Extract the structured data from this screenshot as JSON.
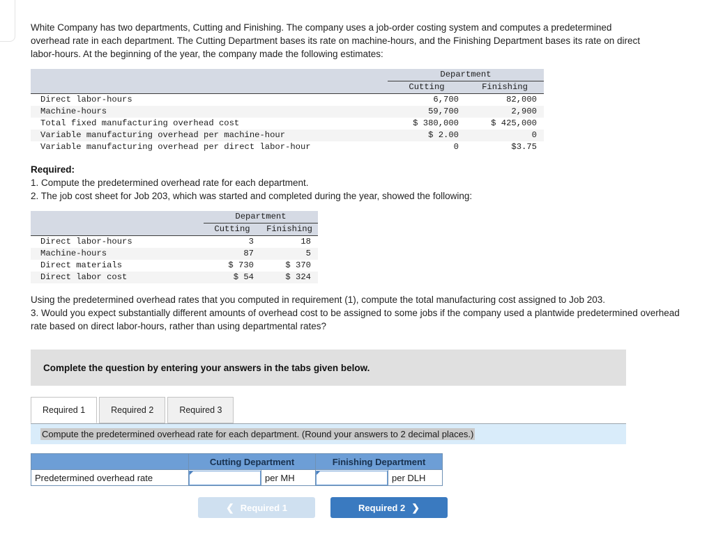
{
  "intro": {
    "paragraph": "White Company has two departments, Cutting and Finishing. The company uses a job-order costing system and computes a predetermined overhead rate in each department. The Cutting Department bases its rate on machine-hours, and the Finishing Department bases its rate on direct labor-hours. At the beginning of the year, the company made the following estimates:"
  },
  "estimates_table": {
    "group_header": "Department",
    "col_headers": [
      "Cutting",
      "Finishing"
    ],
    "rows": [
      {
        "label": "Direct labor-hours",
        "cutting": "6,700",
        "finishing": "82,000"
      },
      {
        "label": "Machine-hours",
        "cutting": "59,700",
        "finishing": "2,900"
      },
      {
        "label": "Total fixed manufacturing overhead cost",
        "cutting": "$ 380,000",
        "finishing": "$ 425,000"
      },
      {
        "label": "Variable manufacturing overhead per machine-hour",
        "cutting": "$ 2.00",
        "finishing": "0"
      },
      {
        "label": "Variable manufacturing overhead per direct labor-hour",
        "cutting": "0",
        "finishing": "$3.75"
      }
    ]
  },
  "required": {
    "heading": "Required:",
    "item1": "1. Compute the predetermined overhead rate for each department.",
    "item2": "2. The job cost sheet for Job 203, which was started and completed during the year, showed the following:"
  },
  "job_table": {
    "group_header": "Department",
    "col_headers": [
      "Cutting",
      "Finishing"
    ],
    "rows": [
      {
        "label": "Direct labor-hours",
        "cutting": "3",
        "finishing": "18"
      },
      {
        "label": "Machine-hours",
        "cutting": "87",
        "finishing": "5"
      },
      {
        "label": "Direct materials",
        "cutting": "$ 730",
        "finishing": "$ 370"
      },
      {
        "label": "Direct labor cost",
        "cutting": "$ 54",
        "finishing": "$ 324"
      }
    ]
  },
  "after_tables": {
    "para1": "Using the predetermined overhead rates that you computed in requirement (1), compute the total manufacturing cost assigned to Job 203.",
    "para2": "3. Would you expect substantially different amounts of overhead cost to be assigned to some jobs if the company used a plantwide predetermined overhead rate based on direct labor-hours, rather than using departmental rates?"
  },
  "banner": {
    "text": "Complete the question by entering your answers in the tabs given below."
  },
  "tabs": [
    {
      "label": "Required 1",
      "active": true
    },
    {
      "label": "Required 2",
      "active": false
    },
    {
      "label": "Required 3",
      "active": false
    }
  ],
  "req_bar": {
    "text": "Compute the predetermined overhead rate for each department. (Round your answers to 2 decimal places.)"
  },
  "answer_table": {
    "header_blank": "",
    "header_cutting": "Cutting Department",
    "header_finishing": "Finishing Department",
    "row_label": "Predetermined overhead rate",
    "cutting_value": "",
    "cutting_unit": "per MH",
    "finishing_value": "",
    "finishing_unit": "per DLH"
  },
  "nav": {
    "prev_label": "Required 1",
    "prev_icon": "chevron-left-icon",
    "next_label": "Required 2",
    "next_icon": "chevron-right-icon"
  },
  "colors": {
    "table_header_bg": "#d5dae4",
    "banner_bg": "#e0e0e0",
    "req_bar_bg": "#d9ecfa",
    "answer_header_blue": "#6d9ed6",
    "next_button_blue": "#3a7ac0",
    "prev_button_blue": "#cfe0f0"
  }
}
